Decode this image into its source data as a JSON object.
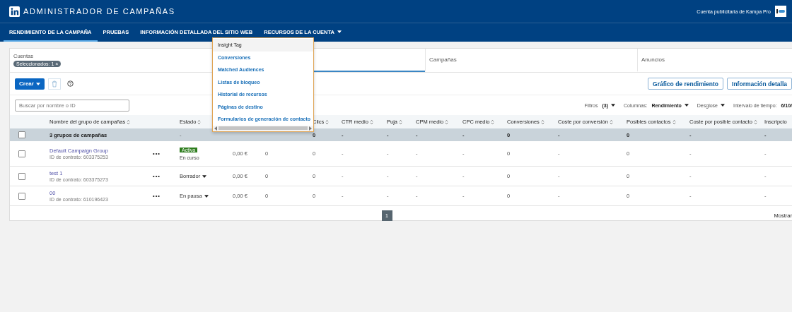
{
  "header": {
    "title": "ADMINISTRADOR DE CAMPAÑAS",
    "account": "Cuenta publicitaria de Kampa Pro"
  },
  "nav": [
    {
      "label": "RENDIMIENTO DE LA CAMPAÑA",
      "selected": true
    },
    {
      "label": "PRUEBAS",
      "selected": false
    },
    {
      "label": "INFORMACIÓN DETALLADA DEL SITIO WEB",
      "selected": false
    },
    {
      "label": "RECURSOS DE LA CUENTA",
      "selected": false,
      "expanded": true
    }
  ],
  "menu": {
    "items": [
      {
        "label": "Insight Tag",
        "selected": true
      },
      {
        "label": "Conversiones",
        "selected": false
      },
      {
        "label": "Matched Audiences",
        "selected": false
      },
      {
        "label": "Listas de bloqueo",
        "selected": false
      },
      {
        "label": "Historial de recursos",
        "selected": false
      },
      {
        "label": "Páginas de destino",
        "selected": false
      },
      {
        "label": "Formularios de generación de contacto",
        "selected": false
      }
    ]
  },
  "entity_tabs": [
    {
      "kind": "accounts",
      "label": "Cuentas",
      "chip": "Seleccionados: 1",
      "chip_close": "×",
      "selected": false
    },
    {
      "kind": "tab",
      "selected": true
    },
    {
      "kind": "tab",
      "label": "Campañas",
      "selected": false
    },
    {
      "kind": "tab",
      "label": "Anuncios",
      "selected": false
    }
  ],
  "toolbar": {
    "create": "Crear",
    "buttons": [
      "Gráfico de rendimiento",
      "Información detalla"
    ]
  },
  "search": {
    "placeholder": "Buscar por nombre o ID"
  },
  "filters": [
    {
      "label": "Filtros",
      "value": "(3)",
      "dropdown": true
    },
    {
      "label": "Columnas:",
      "value": "Rendimiento",
      "dropdown": true
    },
    {
      "label": "Desglose",
      "dropdown": true
    },
    {
      "label": "Intervalo de tiempo:",
      "value": "6/10/",
      "dropdown": false
    }
  ],
  "table": {
    "columns": [
      {
        "label": "Nombre del grupo de campañas",
        "sortable": true
      },
      {
        "label": "Estado",
        "sortable": true
      },
      {
        "label": "Clics",
        "sortable": true
      },
      {
        "label": "CTR medio",
        "sortable": true
      },
      {
        "label": "Puja",
        "sortable": true
      },
      {
        "label": "CPM medio",
        "sortable": true
      },
      {
        "label": "CPC medio",
        "sortable": true
      },
      {
        "label": "Conversiones",
        "sortable": true
      },
      {
        "label": "Coste por conversión",
        "sortable": true
      },
      {
        "label": "Posibles contactos",
        "sortable": true
      },
      {
        "label": "Coste por posible contacto",
        "sortable": true
      },
      {
        "label": "Inscripcio",
        "sortable": false
      }
    ],
    "total": {
      "checked": false,
      "name": "3 grupos de campañas",
      "status": "-",
      "metrics": [
        "0",
        "-",
        "-",
        "-",
        "-",
        "0",
        "-",
        "0",
        "-",
        "-"
      ]
    },
    "rows": [
      {
        "checked": false,
        "name": "Default Campaign Group",
        "contract": "ID de contrato: 603375253",
        "menu": "•••",
        "status": {
          "kind": "badge",
          "label": "Activa",
          "detail": "En curso"
        },
        "column_4": "0,00 €",
        "column_5": "0",
        "metrics": [
          "0",
          "-",
          "-",
          "-",
          "-",
          "0",
          "-",
          "0",
          "-",
          "-"
        ]
      },
      {
        "checked": false,
        "name": "test 1",
        "contract": "ID de contrato: 603375273",
        "menu": "•••",
        "status": {
          "kind": "dropdown",
          "label": "Borrador"
        },
        "column_4": "0,00 €",
        "column_5": "0",
        "metrics": [
          "0",
          "-",
          "-",
          "-",
          "-",
          "0",
          "-",
          "0",
          "-",
          "-"
        ]
      },
      {
        "checked": false,
        "name": "00",
        "contract": "ID de contrato: 610196423",
        "menu": "•••",
        "status": {
          "kind": "dropdown",
          "label": "En pausa"
        },
        "column_4": "0,00 €",
        "column_5": "0",
        "metrics": [
          "0",
          "-",
          "-",
          "-",
          "-",
          "0",
          "-",
          "0",
          "-",
          "-"
        ]
      }
    ]
  },
  "pagination": {
    "pages": [
      {
        "label": "1",
        "selected": true
      }
    ],
    "show": "Mostrar"
  }
}
